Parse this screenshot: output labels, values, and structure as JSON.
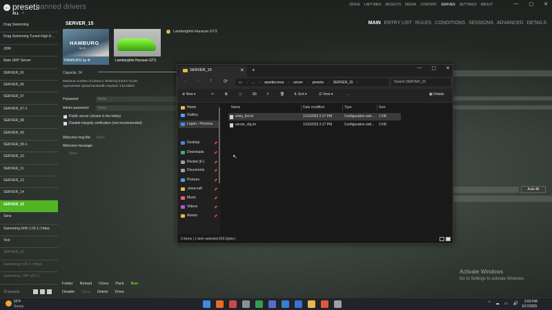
{
  "header": {
    "back_glyph": "←",
    "title": "presets",
    "secondary_title": "banned drivers",
    "filter_label": "ALL",
    "search_glyph": "⌕"
  },
  "top_nav": [
    "DRIVE",
    "LAPTIMES",
    "RESULTS",
    "MEDIA",
    "CONTENT",
    "SERVER",
    "SETTINGS",
    "ABOUT"
  ],
  "top_nav_active": "SERVER",
  "window_controls": [
    "—",
    "▢",
    "✕"
  ],
  "presets": [
    {
      "label": "Drag Swimming",
      "state": "normal"
    },
    {
      "label": "Drag Swimming Tuned High 8…",
      "state": "normal"
    },
    {
      "label": "JDM",
      "state": "normal"
    },
    {
      "label": "Main SRP Server",
      "state": "normal"
    },
    {
      "label": "SERVER_01",
      "state": "normal"
    },
    {
      "label": "SERVER_06",
      "state": "normal"
    },
    {
      "label": "SERVER_07",
      "state": "normal"
    },
    {
      "label": "SERVER_07-1",
      "state": "normal"
    },
    {
      "label": "SERVER_08",
      "state": "normal"
    },
    {
      "label": "SERVER_09",
      "state": "normal"
    },
    {
      "label": "SERVER_09-1",
      "state": "normal"
    },
    {
      "label": "SERVER_10",
      "state": "normal"
    },
    {
      "label": "SERVER_11",
      "state": "normal"
    },
    {
      "label": "SERVER_12",
      "state": "normal"
    },
    {
      "label": "SERVER_14",
      "state": "normal"
    },
    {
      "label": "SERVER_15",
      "state": "active"
    },
    {
      "label": "Sims",
      "state": "normal"
    },
    {
      "label": "Swimming Drift | US-1 | https:",
      "state": "normal"
    },
    {
      "label": "Test",
      "state": "normal"
    },
    {
      "label": "SERVER_16",
      "state": "dim"
    },
    {
      "label": "Swimming | US-1 | https:",
      "state": "dim"
    },
    {
      "label": "Swimming | VIP US-1 |",
      "state": "dim"
    }
  ],
  "list_footer": {
    "count_label": "23 presets"
  },
  "server": {
    "title": "SERVER_15",
    "tabs": [
      "MAIN",
      "ENTRY LIST",
      "RULES",
      "CONDITIONS",
      "SESSIONS",
      "ADVANCED",
      "DETAILS"
    ],
    "active_tab": "MAIN",
    "track": {
      "logo": "HAMBURG",
      "logo_sub": "by 4r",
      "caption": "HAMBURG by 4r"
    },
    "car": {
      "caption": "Lamborghini Huracan GT3",
      "name": "Lamborghini Huracan GT3"
    },
    "capacity_label": "Capacity: 24",
    "capacity_note1": "Maximum number of clients is limited by track's 72 pits",
    "capacity_note2": "Approximate upload bandwidth required: 3.82 Mbit/s",
    "password_label": "Password:",
    "password_value": "None",
    "admin_password_label": "Admin password:",
    "admin_password_value": "None",
    "public_server_label": "Public server (shown in the lobby)",
    "public_server_checked": true,
    "disable_integrity_label": "Disable integrity verification (not recommended)",
    "disable_integrity_checked": false,
    "welcome_file_label": "Welcome msg file:",
    "welcome_file_value": "None",
    "welcome_msg_label": "Welcome message:",
    "welcome_msg_value": "None",
    "autofill_label": "Auto-fill"
  },
  "action_bar": {
    "row1": [
      "Folder",
      "Reload",
      "Clone",
      "Pack",
      "Run"
    ],
    "row2": [
      "Disable",
      "Save",
      "Delete",
      "Drive"
    ]
  },
  "activate_windows": {
    "title": "Activate Windows",
    "subtitle": "Go to Settings to activate Windows."
  },
  "explorer": {
    "tab_title": "SERVER_15",
    "tab_close": "✕",
    "new_tab": "+",
    "window_controls": [
      "—",
      "▢",
      "✕"
    ],
    "nav_glyphs": [
      "←",
      "→",
      "↑",
      "⟳",
      "▭",
      "…"
    ],
    "breadcrumb": [
      "assettocorsa",
      "server",
      "presets",
      "SERVER_15"
    ],
    "breadcrumb_sep": "›",
    "search_placeholder": "Search SERVER_15",
    "toolbar": {
      "new": "New",
      "sort": "Sort",
      "view": "View",
      "more": "…",
      "details": "Details"
    },
    "nav_items": [
      {
        "label": "Home",
        "color": "#e8b84a",
        "pinned": false
      },
      {
        "label": "Gallery",
        "color": "#4aa3e8",
        "pinned": false
      },
      {
        "label": "Logan - Persona",
        "color": "#4a8be8",
        "pinned": false
      },
      {
        "label": "Desktop",
        "color": "#3d8ce0",
        "pinned": true
      },
      {
        "label": "Downloads",
        "color": "#3dae64",
        "pinned": true
      },
      {
        "label": "Rocket (E:)",
        "color": "#9aa0a6",
        "pinned": true
      },
      {
        "label": "Documents",
        "color": "#9aa0a6",
        "pinned": true
      },
      {
        "label": "Pictures",
        "color": "#4aa3e8",
        "pinned": true
      },
      {
        "label": ".minecraft",
        "color": "#e8b84a",
        "pinned": true
      },
      {
        "label": "Music",
        "color": "#e8607a",
        "pinned": true
      },
      {
        "label": "Videos",
        "color": "#a05ee0",
        "pinned": true
      },
      {
        "label": "Assets",
        "color": "#e8b84a",
        "pinned": true
      }
    ],
    "pin_glyph": "📌",
    "columns": [
      "Name",
      "Date modified",
      "Type",
      "Size"
    ],
    "files": [
      {
        "name": "entry_list.ini",
        "date": "1/15/2025 2:17 PM",
        "type": "Configuration sett...",
        "size": "1 KB",
        "selected": true
      },
      {
        "name": "server_cfg.ini",
        "date": "1/15/2025 2:17 PM",
        "type": "Configuration sett...",
        "size": "3 KB",
        "selected": false
      }
    ],
    "status": "2 items  |  1 item selected  816 bytes  |"
  },
  "taskbar": {
    "temperature": "52°F",
    "weather": "Sunny",
    "time": "2:03 PM",
    "date": "1/17/2025",
    "tray_glyphs": [
      "^",
      "☁",
      "▭",
      "🔊"
    ]
  },
  "colors": {
    "accent_green": "#51b521",
    "run_green": "#6ddc2c",
    "explorer_bg": "#191919"
  }
}
